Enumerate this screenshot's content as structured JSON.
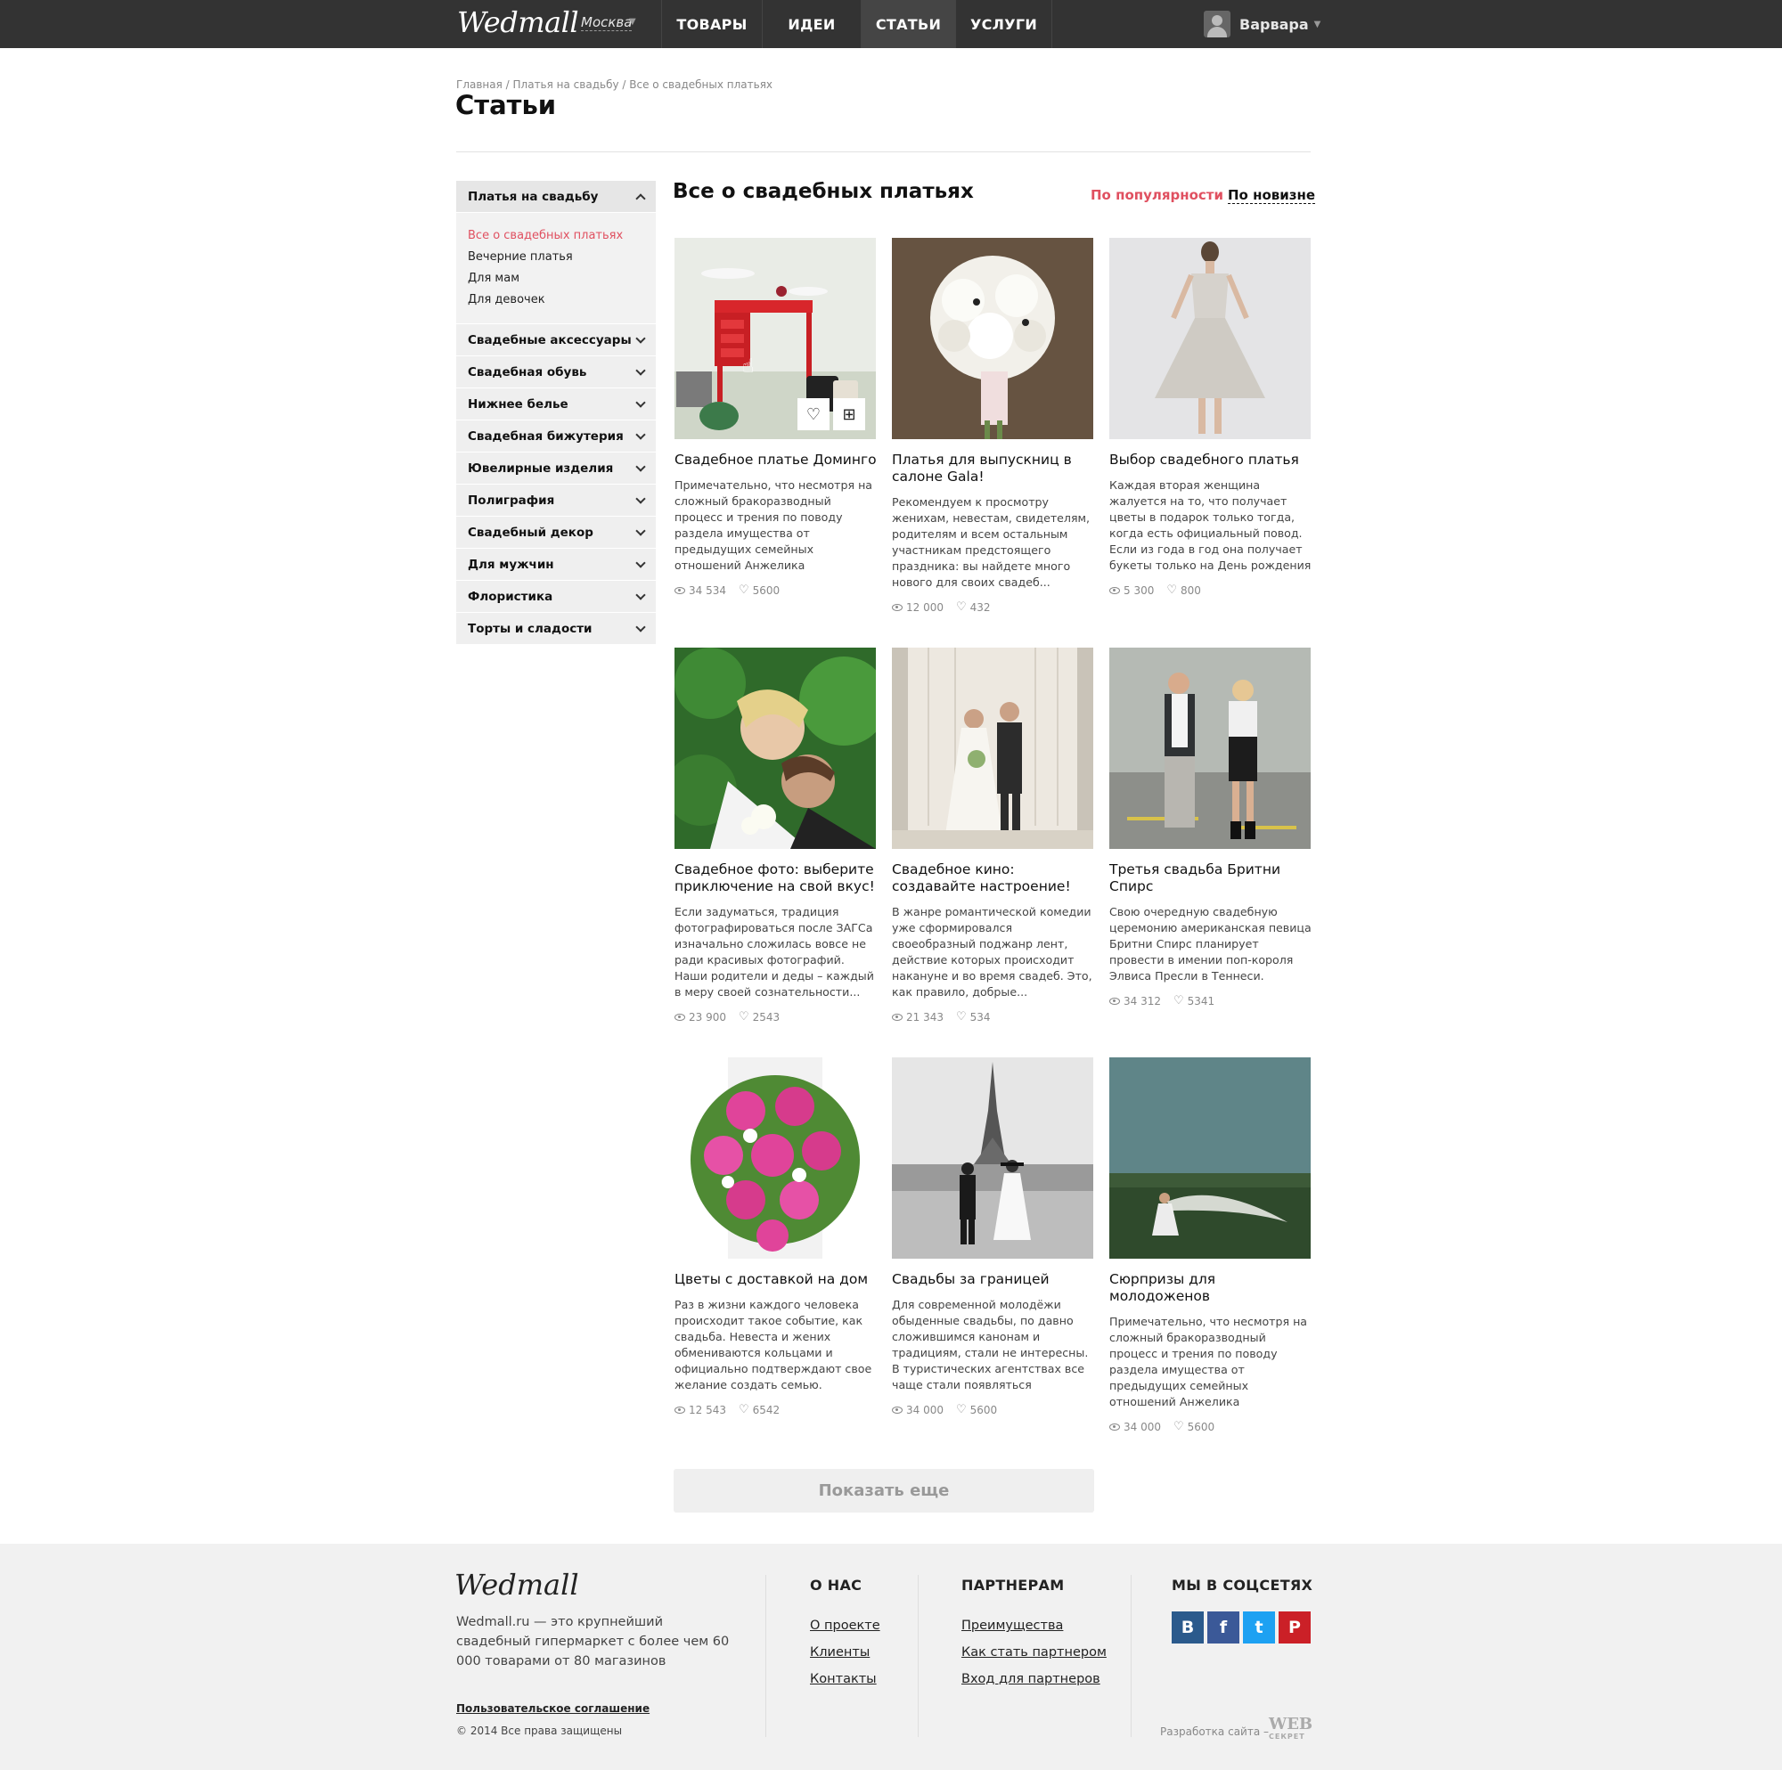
{
  "header": {
    "logo": "Wedmall",
    "city": "Москва",
    "nav": [
      {
        "label": "ТОВАРЫ"
      },
      {
        "label": "ИДЕИ"
      },
      {
        "label": "СТАТЬИ"
      },
      {
        "label": "УСЛУГИ"
      }
    ],
    "user_name": "Варвара"
  },
  "breadcrumb": [
    "Главная",
    "Платья на свадьбу",
    "Все о свадебных платьях"
  ],
  "breadcrumb_sep": " / ",
  "page_title": "Статьи",
  "sidebar": {
    "open_category": "Платья на свадьбу",
    "subcategories": [
      "Все о свадебных платьях",
      "Вечерние платья",
      "Для мам",
      "Для девочек"
    ],
    "categories": [
      "Свадебные аксессуары",
      "Свадебная обувь",
      "Нижнее белье",
      "Свадебная бижутерия",
      "Ювелирные изделия",
      "Полиграфия",
      "Свадебный декор",
      "Для мужчин",
      "Флористика",
      "Торты и сладости"
    ]
  },
  "content": {
    "title": "Все о свадебных платьях",
    "sort_popular": "По популярности",
    "sort_new": "По новизне",
    "load_more": "Показать еще"
  },
  "articles": [
    {
      "title": "Свадебное платье Доминго",
      "text": "Примечательно, что несмотря на сложный бракоразводный процесс и трения по поводу раздела имущества от предыдущих семейных отношений Анжелика",
      "views": "34 534",
      "likes": "5600"
    },
    {
      "title": "Платья для выпускниц в салоне Gala!",
      "text": "Рекомендуем к просмотру женихам, невестам, свидетелям, родителям и всем остальным участникам предстоящего праздника: вы найдете много нового для своих свадеб...",
      "views": "12 000",
      "likes": "432"
    },
    {
      "title": "Выбор свадебного платья",
      "text": "Каждая вторая женщина жалуется на то, что получает цветы в подарок только тогда, когда есть официальный повод. Если из года в год она получает букеты только на День рождения",
      "views": "5 300",
      "likes": "800"
    },
    {
      "title": "Свадебное фото: выберите приключение на свой вкус!",
      "text": "Если задуматься, традиция фотографироваться после ЗАГСа изначально сложилась вовсе не ради красивых фотографий. Наши родители и деды – каждый в меру своей сознательности...",
      "views": "23 900",
      "likes": "2543"
    },
    {
      "title": "Свадебное кино: создавайте настроение!",
      "text": "В жанре романтической комедии уже сформировался своеобразный поджанр лент, действие которых происходит накануне и во время свадеб. Это, как правило, добрые...",
      "views": "21 343",
      "likes": "534"
    },
    {
      "title": "Третья свадьба Бритни Спирс",
      "text": "Свою очередную свадебную церемонию американская певица Бритни Спирс планирует провести в имении поп-короля Элвиса Пресли в Теннеси.",
      "views": "34 312",
      "likes": "5341"
    },
    {
      "title": "Цветы с доставкой на дом",
      "text": "Раз в жизни каждого человека происходит такое событие, как свадьба. Невеста и жених обмениваются кольцами и официально подтверждают свое желание создать семью.",
      "views": "12 543",
      "likes": "6542"
    },
    {
      "title": "Свадьбы за границей",
      "text": "Для современной молодёжи обыденные свадьбы, по давно сложившимся канонам и традициям, стали не интересны. В туристических агентствах все чаще стали появляться",
      "views": "34 000",
      "likes": "5600"
    },
    {
      "title": "Сюрпризы для молодоженов",
      "text": "Примечательно, что несмотря на сложный бракоразводный процесс и трения по поводу раздела имущества от предыдущих семейных отношений Анжелика",
      "views": "34 000",
      "likes": "5600"
    }
  ],
  "footer": {
    "logo": "Wedmall",
    "about": "Wedmall.ru — это крупнейший свадебный гипермаркет с более чем 60 000 товарами от 80 магазинов",
    "agreement": "Пользовательское соглашение",
    "copyright": "© 2014 Все права защищены",
    "col_about_title": "О НАС",
    "col_about_links": [
      "О проекте",
      "Клиенты",
      "Контакты"
    ],
    "col_partners_title": "ПАРТНЕРАМ",
    "col_partners_links": [
      "Преимущества",
      "Как стать партнером",
      "Вход для партнеров"
    ],
    "social_title": "МЫ В СОЦСЕТЯХ",
    "social": [
      {
        "icon": "vk-icon",
        "glyph": "В",
        "color": "#2b5a8c"
      },
      {
        "icon": "facebook-icon",
        "glyph": "f",
        "color": "#3b5998"
      },
      {
        "icon": "twitter-icon",
        "glyph": "t",
        "color": "#1da1f2"
      },
      {
        "icon": "pinterest-icon",
        "glyph": "P",
        "color": "#cb2027"
      }
    ],
    "dev_label": "Разработка сайта  –",
    "dev_brand": "WEB",
    "dev_brand_sub": "СЕКРЕТ"
  },
  "colors": {
    "accent": "#e05060",
    "topbar": "#333333"
  }
}
